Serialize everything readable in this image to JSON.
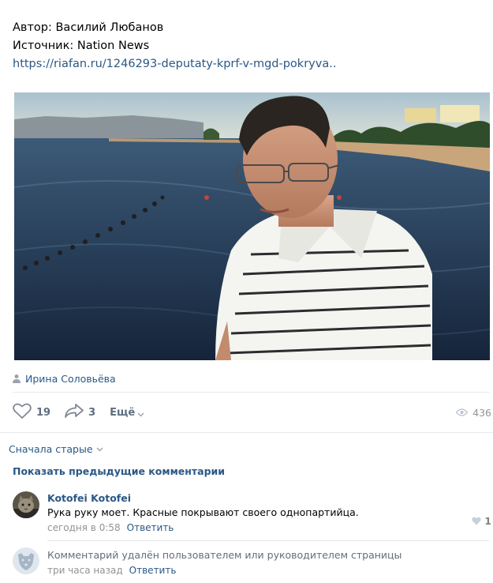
{
  "post": {
    "author_line": "Автор: Василий Любанов",
    "source_line": "Источник: Nation News",
    "link": "https://riafan.ru/1246293-deputaty-kprf-v-mgd-pokryva..",
    "signer": "Ирина Соловьёва",
    "icons": {
      "signer": "person-icon",
      "like": "heart-icon",
      "share": "share-arrow-icon",
      "more_caret": "chevron-down-icon",
      "views": "eye-icon"
    },
    "likes": "19",
    "shares": "3",
    "more_label": "Ещё",
    "views": "436"
  },
  "comments_section": {
    "sort_label": "Сначала старые",
    "show_previous": "Показать предыдущие комментарии",
    "items": [
      {
        "author": "Kotofei Kotofei",
        "text": "Рука руку моет. Красные покрывают своего однопартийца.",
        "time": "сегодня в 0:58",
        "reply_label": "Ответить",
        "likes": "1",
        "avatar_icon": "cat-avatar"
      },
      {
        "text": "Комментарий удалён пользователем или руководителем страницы",
        "time": "три часа назад",
        "reply_label": "Ответить",
        "avatar_icon": "deactivated-dog-avatar"
      }
    ]
  },
  "colors": {
    "link": "#2a5885",
    "secondary": "#939393",
    "divider": "#e7e8ec",
    "action": "#5e6e80"
  }
}
